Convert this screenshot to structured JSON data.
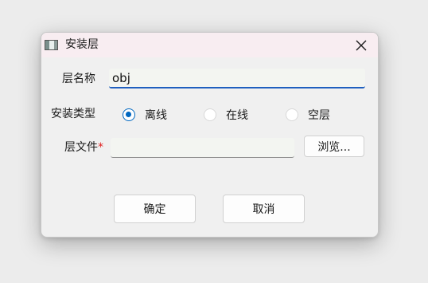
{
  "window": {
    "title": "安装层"
  },
  "form": {
    "name_label": "层名称",
    "name_value": "obj",
    "type_label": "安装类型",
    "type_options": [
      {
        "label": "离线",
        "selected": true
      },
      {
        "label": "在线",
        "selected": false
      },
      {
        "label": "空层",
        "selected": false
      }
    ],
    "file_label": "层文件",
    "file_required_mark": "*",
    "file_value": "",
    "browse_label": "浏览..."
  },
  "buttons": {
    "ok_label": "确定",
    "cancel_label": "取消"
  },
  "icons": {
    "app": "window-app-icon",
    "close": "close-icon"
  },
  "colors": {
    "accent": "#0067c0",
    "input_underline_focus": "#1f5fbf",
    "required": "#e02020",
    "titlebar_bg": "#f8edf1"
  }
}
